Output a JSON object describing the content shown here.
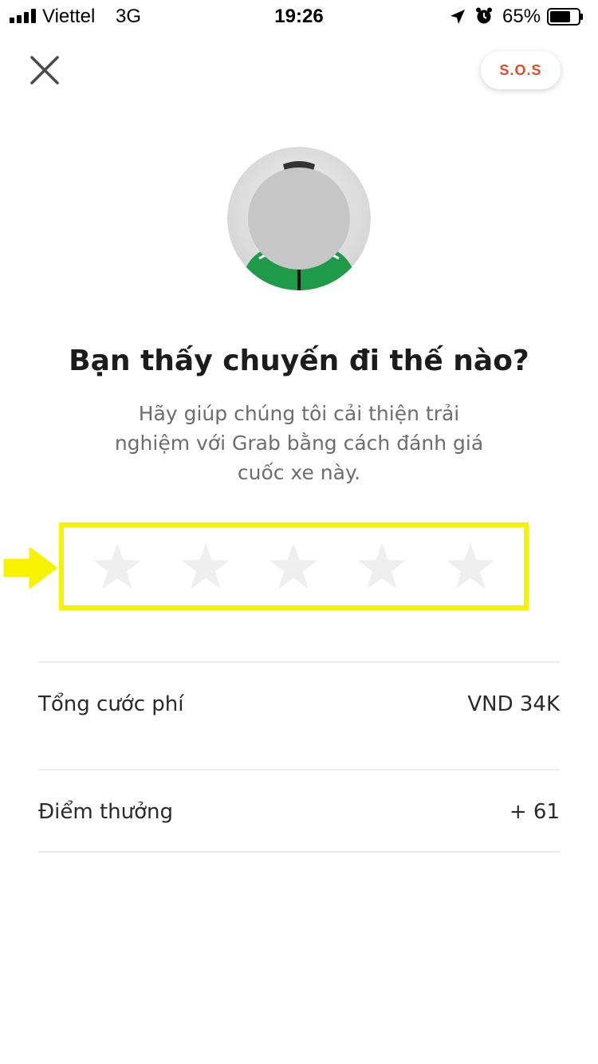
{
  "status_bar": {
    "carrier": "Viettel",
    "network": "3G",
    "time": "19:26",
    "battery": "65%"
  },
  "header": {
    "close_icon": "close-icon",
    "sos_label": "S.O.S"
  },
  "rating": {
    "title": "Bạn thấy chuyến đi thế nào?",
    "subtitle_lines": [
      "Hãy giúp chúng tôi cải thiện trải",
      "nghiệm với Grab bằng cách đánh giá",
      "cuốc xe này."
    ],
    "stars_total": 5,
    "stars_selected": 0
  },
  "summary": {
    "total_fare_label": "Tổng cước phí",
    "total_fare_value": "VND 34K",
    "points_label": "Điểm thưởng",
    "points_value": "+ 61"
  },
  "colors": {
    "sos_red": "#e24a2b",
    "highlight_yellow": "#f7f200",
    "star_empty": "#efefef",
    "jacket_green": "#1f9a48"
  }
}
